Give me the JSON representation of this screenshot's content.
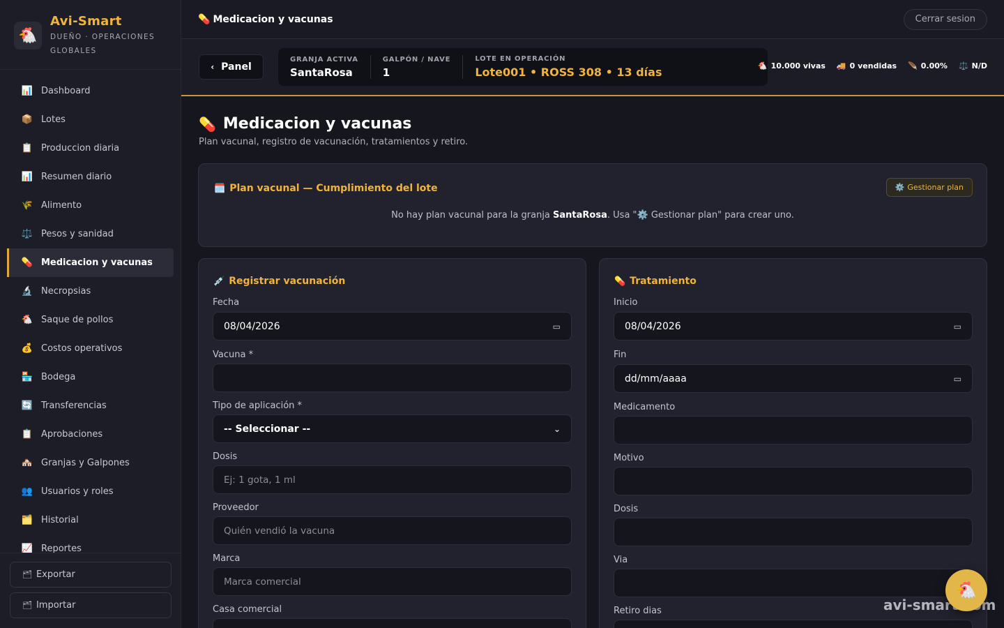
{
  "brand": {
    "name": "Avi-Smart",
    "subtitle_line1": "DUEÑO · OPERACIONES",
    "subtitle_line2": "GLOBALES",
    "logo_icon": "chicken-icon"
  },
  "sidebar": {
    "items": [
      {
        "label": "Dashboard",
        "icon": "📊",
        "icon_name": "bar-chart-icon"
      },
      {
        "label": "Lotes",
        "icon": "📦",
        "icon_name": "box-icon"
      },
      {
        "label": "Produccion diaria",
        "icon": "📋",
        "icon_name": "clipboard-icon"
      },
      {
        "label": "Resumen diario",
        "icon": "📊",
        "icon_name": "bar-chart-icon"
      },
      {
        "label": "Alimento",
        "icon": "🌾",
        "icon_name": "grain-icon"
      },
      {
        "label": "Pesos y sanidad",
        "icon": "⚖️",
        "icon_name": "scale-icon"
      },
      {
        "label": "Medicacion y vacunas",
        "icon": "💊",
        "icon_name": "pill-icon",
        "active": true
      },
      {
        "label": "Necropsias",
        "icon": "🔬",
        "icon_name": "microscope-icon"
      },
      {
        "label": "Saque de pollos",
        "icon": "🐔",
        "icon_name": "chicken-icon"
      },
      {
        "label": "Costos operativos",
        "icon": "💰",
        "icon_name": "money-bag-icon"
      },
      {
        "label": "Bodega",
        "icon": "🏪",
        "icon_name": "store-icon"
      },
      {
        "label": "Transferencias",
        "icon": "🔄",
        "icon_name": "transfer-icon"
      },
      {
        "label": "Aprobaciones",
        "icon": "📋",
        "icon_name": "clipboard-icon"
      },
      {
        "label": "Granjas y Galpones",
        "icon": "🏘️",
        "icon_name": "farm-icon"
      },
      {
        "label": "Usuarios y roles",
        "icon": "👥",
        "icon_name": "users-icon"
      },
      {
        "label": "Historial",
        "icon": "🗂️",
        "icon_name": "folder-icon"
      },
      {
        "label": "Reportes",
        "icon": "📈",
        "icon_name": "line-chart-icon"
      }
    ],
    "export_label": "Exportar",
    "import_label": "Importar"
  },
  "topbar": {
    "title": "Medicacion y vacunas",
    "logout_label": "Cerrar sesion"
  },
  "context": {
    "back_label": "Panel",
    "farm_label": "GRANJA ACTIVA",
    "farm_value": "SantaRosa",
    "shed_label": "GALPÓN / NAVE",
    "shed_value": "1",
    "batch_label": "LOTE EN OPERACIÓN",
    "batch_value": "Lote001 • ROSS 308 • 13 días",
    "stats": {
      "alive": "10.000 vivas",
      "sold": "0 vendidas",
      "mortality": "0.00%",
      "weight": "N/D"
    }
  },
  "page": {
    "title": "Medicacion y vacunas",
    "subtitle": "Plan vacunal, registro de vacunación, tratamientos y retiro."
  },
  "plan": {
    "title": "Plan vacunal — Cumplimiento del lote",
    "manage_label": "Gestionar plan",
    "msg_prefix": "No hay plan vacunal para la granja ",
    "msg_farm": "SantaRosa",
    "msg_mid": ". Usa \"",
    "msg_suffix": " Gestionar plan\" para crear uno."
  },
  "vaccination": {
    "title": "Registrar vacunación",
    "date_label": "Fecha",
    "date_value": "08/04/2026",
    "vaccine_label": "Vacuna *",
    "vaccine_value": "",
    "type_label": "Tipo de aplicación *",
    "type_value": "-- Seleccionar --",
    "dose_label": "Dosis",
    "dose_placeholder": "Ej: 1 gota, 1 ml",
    "supplier_label": "Proveedor",
    "supplier_placeholder": "Quién vendió la vacuna",
    "brand_label": "Marca",
    "brand_placeholder": "Marca comercial",
    "house_label": "Casa comercial"
  },
  "treatment": {
    "title": "Tratamiento",
    "start_label": "Inicio",
    "start_value": "08/04/2026",
    "end_label": "Fin",
    "end_value": "dd/mm/aaaa",
    "drug_label": "Medicamento",
    "reason_label": "Motivo",
    "dose_label": "Dosis",
    "route_label": "Via",
    "withdrawal_label": "Retiro dias"
  },
  "watermark": "avi-smart.com",
  "colors": {
    "accent": "#f0b43c",
    "background": "#16161f",
    "sidebar": "#1d1d28",
    "card": "#22222e"
  }
}
